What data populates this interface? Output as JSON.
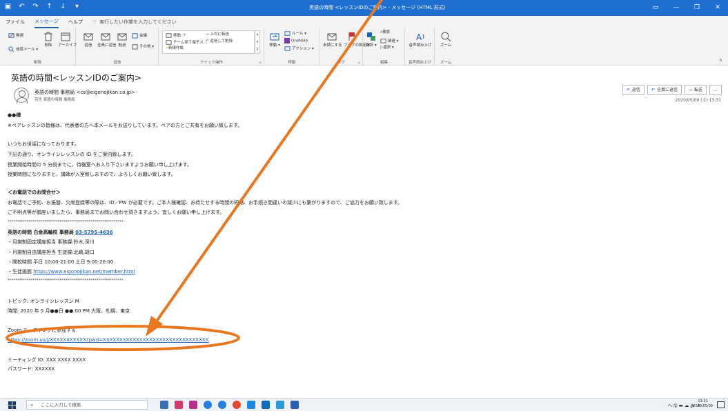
{
  "window": {
    "title": "英語の時間 <レッスンIDのご案内> - メッセージ (HTML 形式)",
    "qat": [
      "保存",
      "元に戻す",
      "やり直し",
      "上へ",
      "下へ",
      "カスタマイズ"
    ],
    "controls": [
      "表示",
      "最小化",
      "元に戻す",
      "閉じる"
    ]
  },
  "tabs": {
    "items": [
      "ファイル",
      "メッセージ",
      "ヘルプ"
    ],
    "active_index": 1,
    "tellme": "実行したい作業を入力してください"
  },
  "ribbon": {
    "groups": {
      "delete": {
        "label": "削除",
        "ignore": "無視",
        "junk": "迷惑メール",
        "delete": "削除",
        "archive": "アーカイブ"
      },
      "respond": {
        "label": "返信",
        "reply": "返信",
        "reply_all": "全員に返信",
        "forward": "転送",
        "meeting": "会議",
        "more": "その他"
      },
      "quicksteps": {
        "label": "クイック操作",
        "move_to": "移動: ?",
        "to_manager": "上司に転送",
        "team_email": "チーム宛て電子メ...",
        "reply_delete": "返信して削除",
        "create_new": "新規作成"
      },
      "move": {
        "label": "移動",
        "move": "移動",
        "rules": "ルール",
        "onenote": "OneNote",
        "actions": "アクション"
      },
      "tags": {
        "label": "タグ",
        "unread": "未読にする",
        "flag": "フラグの設定"
      },
      "editing": {
        "label": "編集",
        "translate": "翻訳",
        "find": "検索",
        "related": "関連",
        "select": "選択"
      },
      "speech": {
        "label": "音声読み上げ",
        "read_aloud": "音声読み上げ"
      },
      "zoom": {
        "label": "ズーム",
        "zoom": "ズーム"
      }
    }
  },
  "message": {
    "subject": "英語の時間<レッスンIDのご案内>",
    "sender": "英語の時間 事務局 <cs@eigonojikan.co.jp>",
    "recipient": "宛先 英語の時間 事務局",
    "sent": "2020/05/09 (土) 13:31",
    "actions": {
      "reply": "返信",
      "reply_all": "全員に返信",
      "forward": "転送",
      "more": "…"
    },
    "body": {
      "salutation": "●●様",
      "pair_note": "※ペアレッスンの皆様は、代表者の方へ本メールをお送りしています。ペアの方とご共有をお願い致します。",
      "p1": "いつもお世話になっております。",
      "p2": "下記の通り、オンラインレッスンの ID をご案内致します。",
      "p3": "授業開始時間の 5 分前までに、待機室へお入り下さいますようお願い申し上げます。",
      "p4": "授業時間になりますと、講師が入室致しますので、よろしくお願い致します。",
      "phone_heading": "＜お電話でのお問合せ＞",
      "phone_1": "お電話でご予約、お振替、欠席登録等の際は、ID／PW が必要です。ご本人様確認、お待たせする時間の短縮、お手続き間違いの減少にも繋がりますので、ご協力をお願い致します。",
      "phone_2": "ご不明点等が御座いましたら、事務局までお問い合わせ頂きますよう、宜しくお願い申し上げます。",
      "stars": "************************************************************",
      "office_name": "英語の時間 白金高輪校 事務局",
      "office_phone": "03-5795-4636",
      "staff_1": "・月謝制固定講座担当 事務課:鈴木,深川",
      "staff_2": "・月謝制自由講座担当 生徒課:北嶋,胡口",
      "hours": "・開校時間 平日 10:00-21:00 土日 9:00-20:00",
      "student_page_label": "・生徒画面 ",
      "student_page_url": "https://www.eigonojikan.net/member.html",
      "topic": "トピック: オンラインレッスン M",
      "time": "時間: 2020 年 5 月●●日 ●●:00 PM 大阪、札幌、東京",
      "join_label": "Zoom ミーティングに参加する",
      "join_url": "https://zoom.us/j/XXXXXXXXXXX?pwd=XXXXXXXXXXXXXXXXXXXXXXXXXXXXXXXX",
      "meeting_id": "ミーティング ID: XXX XXXX XXXX",
      "password": "パスワード: XXXXXX"
    }
  },
  "taskbar": {
    "search_placeholder": "ここに入力して検索",
    "tray": "ヘ 🖫 ▬ ☁ 🔈 A",
    "time": "13:31",
    "date": "2020/05/09"
  },
  "colors": {
    "titlebar": "#1f6fd1",
    "annotation": "#e87722",
    "link": "#1f5fb4"
  }
}
